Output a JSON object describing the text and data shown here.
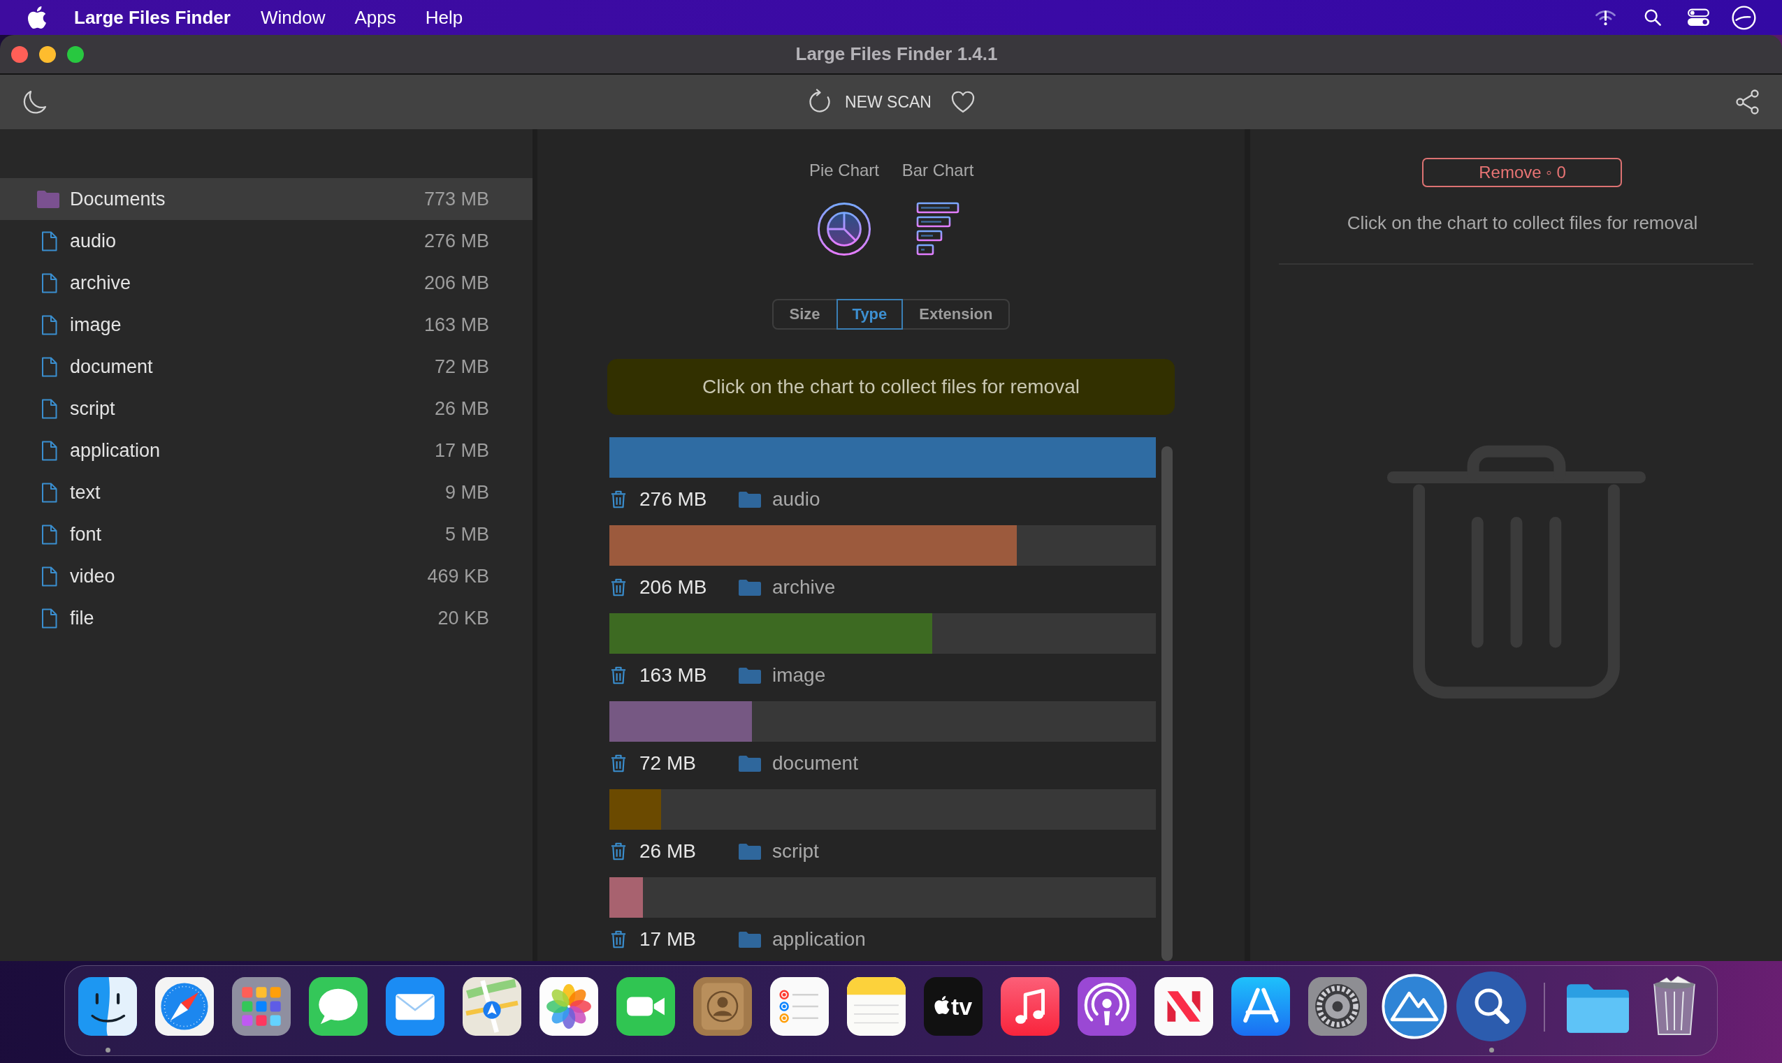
{
  "menu_bar": {
    "app_name": "Large Files Finder",
    "menus": [
      "Window",
      "Apps",
      "Help"
    ]
  },
  "window": {
    "title": "Large Files Finder 1.4.1"
  },
  "toolbar": {
    "scan_button": "NEW SCAN"
  },
  "sidebar": {
    "items": [
      {
        "kind": "folder",
        "name": "Documents",
        "size": "773 MB",
        "selected": true
      },
      {
        "kind": "file",
        "name": "audio",
        "size": "276 MB",
        "selected": false
      },
      {
        "kind": "file",
        "name": "archive",
        "size": "206 MB",
        "selected": false
      },
      {
        "kind": "file",
        "name": "image",
        "size": "163 MB",
        "selected": false
      },
      {
        "kind": "file",
        "name": "document",
        "size": "72 MB",
        "selected": false
      },
      {
        "kind": "file",
        "name": "script",
        "size": "26 MB",
        "selected": false
      },
      {
        "kind": "file",
        "name": "application",
        "size": "17 MB",
        "selected": false
      },
      {
        "kind": "file",
        "name": "text",
        "size": "9 MB",
        "selected": false
      },
      {
        "kind": "file",
        "name": "font",
        "size": "5 MB",
        "selected": false
      },
      {
        "kind": "file",
        "name": "video",
        "size": "469 KB",
        "selected": false
      },
      {
        "kind": "file",
        "name": "file",
        "size": "20 KB",
        "selected": false
      }
    ]
  },
  "chart_picker": {
    "options": [
      {
        "kind": "pie",
        "label": "Pie Chart"
      },
      {
        "kind": "bar",
        "label": "Bar Chart"
      }
    ]
  },
  "group_tabs": [
    {
      "label": "Size",
      "selected": false
    },
    {
      "label": "Type",
      "selected": true
    },
    {
      "label": "Extension",
      "selected": false
    }
  ],
  "hint_banner": "Click on the chart to collect files for removal",
  "bars": [
    {
      "size": "276 MB",
      "name": "audio",
      "level": 1,
      "color": "#2f6ca3"
    },
    {
      "size": "206 MB",
      "name": "archive",
      "level": 0.746,
      "color": "#9c5a3d"
    },
    {
      "size": "163 MB",
      "name": "image",
      "level": 0.591,
      "color": "#3d6a22"
    },
    {
      "size": "72 MB",
      "name": "document",
      "level": 0.261,
      "color": "#765883"
    },
    {
      "size": "26 MB",
      "name": "script",
      "level": 0.094,
      "color": "#6b4a00"
    },
    {
      "size": "17 MB",
      "name": "application",
      "level": 0.062,
      "color": "#a8626f"
    }
  ],
  "removal_panel": {
    "remove_button": "Remove ◦ 0",
    "hint": "Click on the chart to collect files for removal"
  },
  "dock": {
    "apps": [
      {
        "kind": "finder",
        "running": true
      },
      {
        "kind": "safari",
        "running": false
      },
      {
        "kind": "launchpad",
        "running": false
      },
      {
        "kind": "messages",
        "running": false
      },
      {
        "kind": "mail",
        "running": false
      },
      {
        "kind": "maps",
        "running": false
      },
      {
        "kind": "photos",
        "running": false
      },
      {
        "kind": "facetime",
        "running": false
      },
      {
        "kind": "contacts",
        "running": false
      },
      {
        "kind": "reminders",
        "running": false
      },
      {
        "kind": "notes",
        "running": false
      },
      {
        "kind": "tv",
        "label": "tv",
        "running": false
      },
      {
        "kind": "music",
        "running": false
      },
      {
        "kind": "podcasts",
        "running": false
      },
      {
        "kind": "news",
        "running": false
      },
      {
        "kind": "appstore",
        "running": false
      },
      {
        "kind": "settings",
        "running": false
      },
      {
        "kind": "mountain",
        "running": false
      },
      {
        "kind": "magnifier",
        "running": true
      }
    ],
    "stacks": [
      {
        "kind": "folder",
        "running": false
      },
      {
        "kind": "trash",
        "running": false
      }
    ]
  }
}
